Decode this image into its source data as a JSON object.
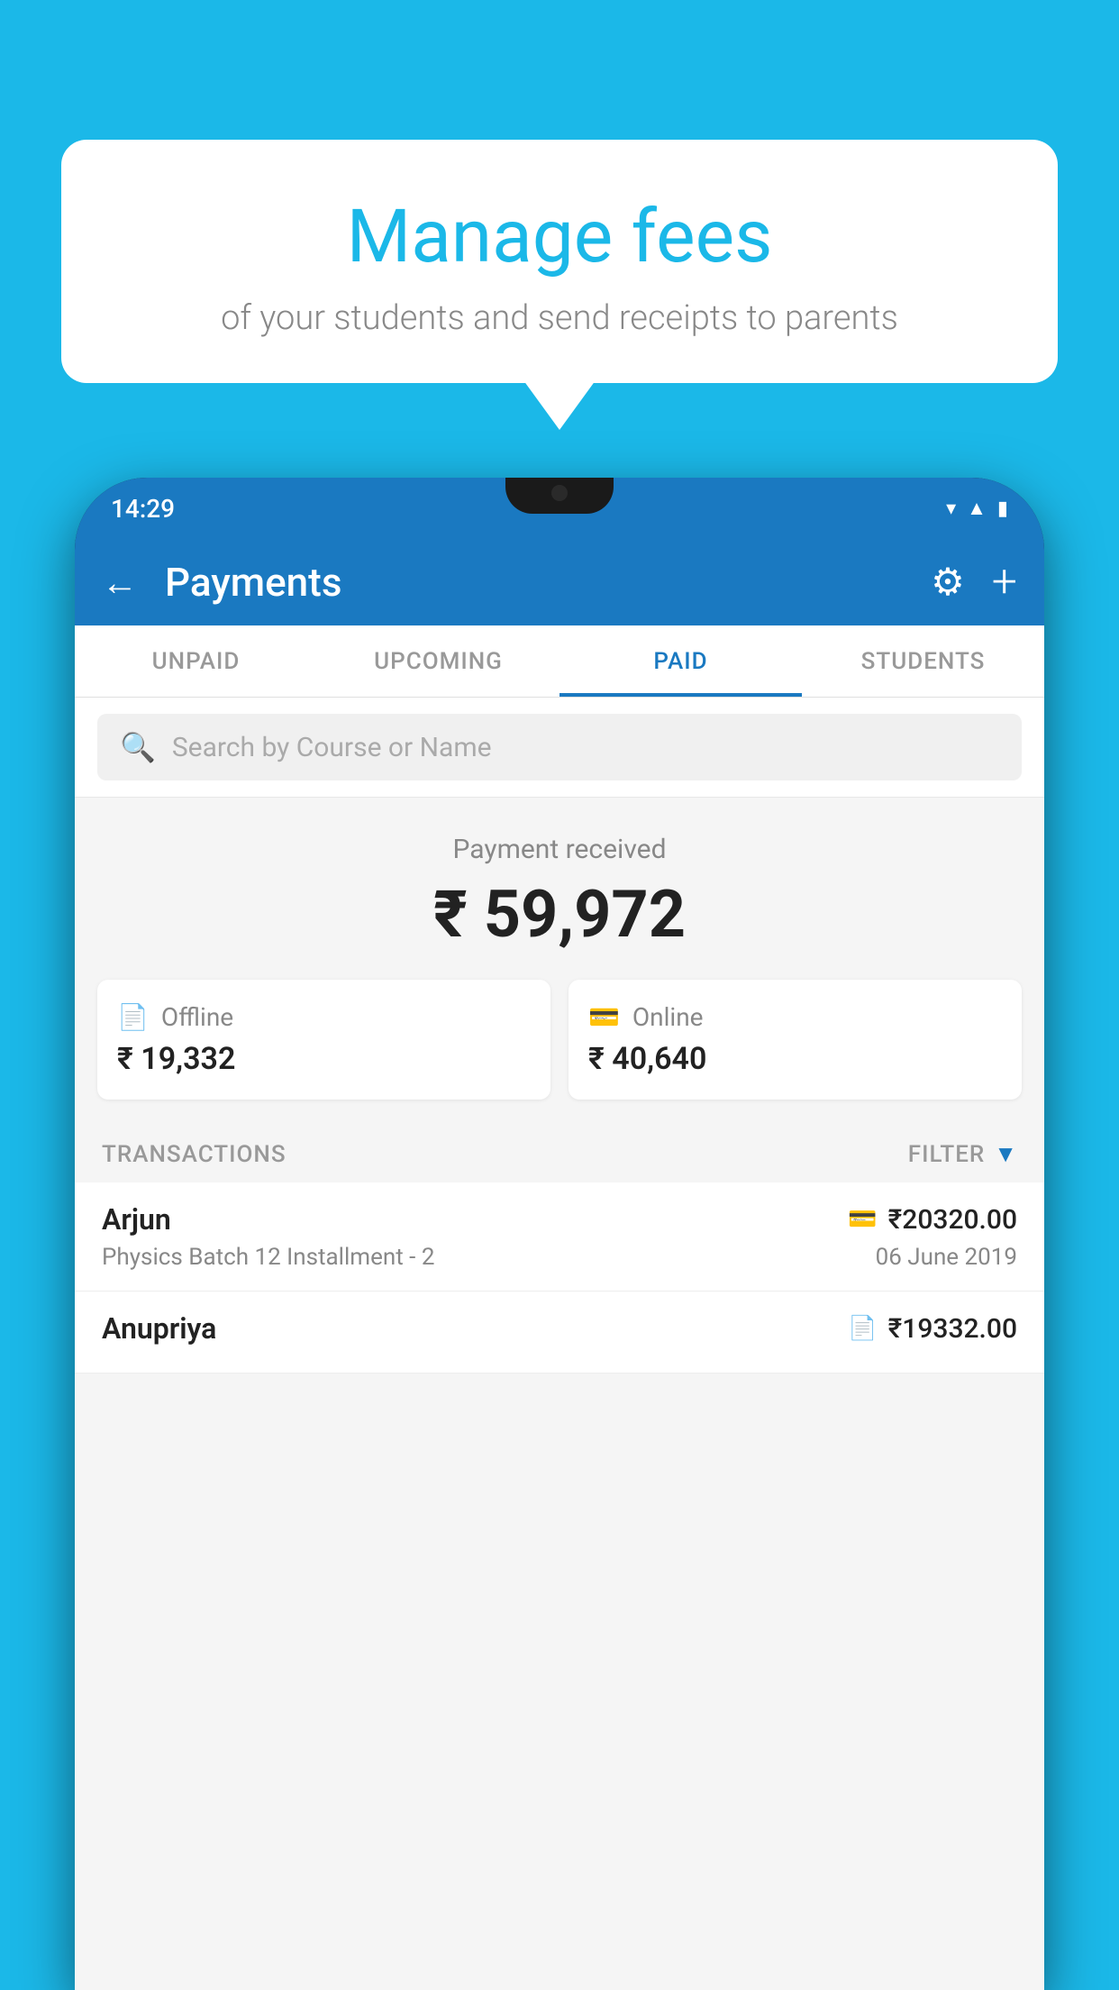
{
  "background": {
    "color": "#1BB8E8"
  },
  "speech_bubble": {
    "title": "Manage fees",
    "subtitle": "of your students and send receipts to parents"
  },
  "status_bar": {
    "time": "14:29",
    "icons": [
      "wifi",
      "signal",
      "battery"
    ]
  },
  "app_header": {
    "title": "Payments",
    "back_label": "←",
    "gear_label": "⚙",
    "plus_label": "+"
  },
  "tabs": [
    {
      "label": "UNPAID",
      "active": false
    },
    {
      "label": "UPCOMING",
      "active": false
    },
    {
      "label": "PAID",
      "active": true
    },
    {
      "label": "STUDENTS",
      "active": false
    }
  ],
  "search": {
    "placeholder": "Search by Course or Name"
  },
  "payment_received": {
    "label": "Payment received",
    "amount": "₹ 59,972"
  },
  "payment_cards": [
    {
      "type": "Offline",
      "amount": "₹ 19,332",
      "icon": "📄"
    },
    {
      "type": "Online",
      "amount": "₹ 40,640",
      "icon": "💳"
    }
  ],
  "transactions_section": {
    "label": "TRANSACTIONS",
    "filter_label": "FILTER"
  },
  "transactions": [
    {
      "name": "Arjun",
      "amount": "₹20320.00",
      "course": "Physics Batch 12 Installment - 2",
      "date": "06 June 2019",
      "payment_type": "online"
    },
    {
      "name": "Anupriya",
      "amount": "₹19332.00",
      "course": "",
      "date": "",
      "payment_type": "offline"
    }
  ]
}
